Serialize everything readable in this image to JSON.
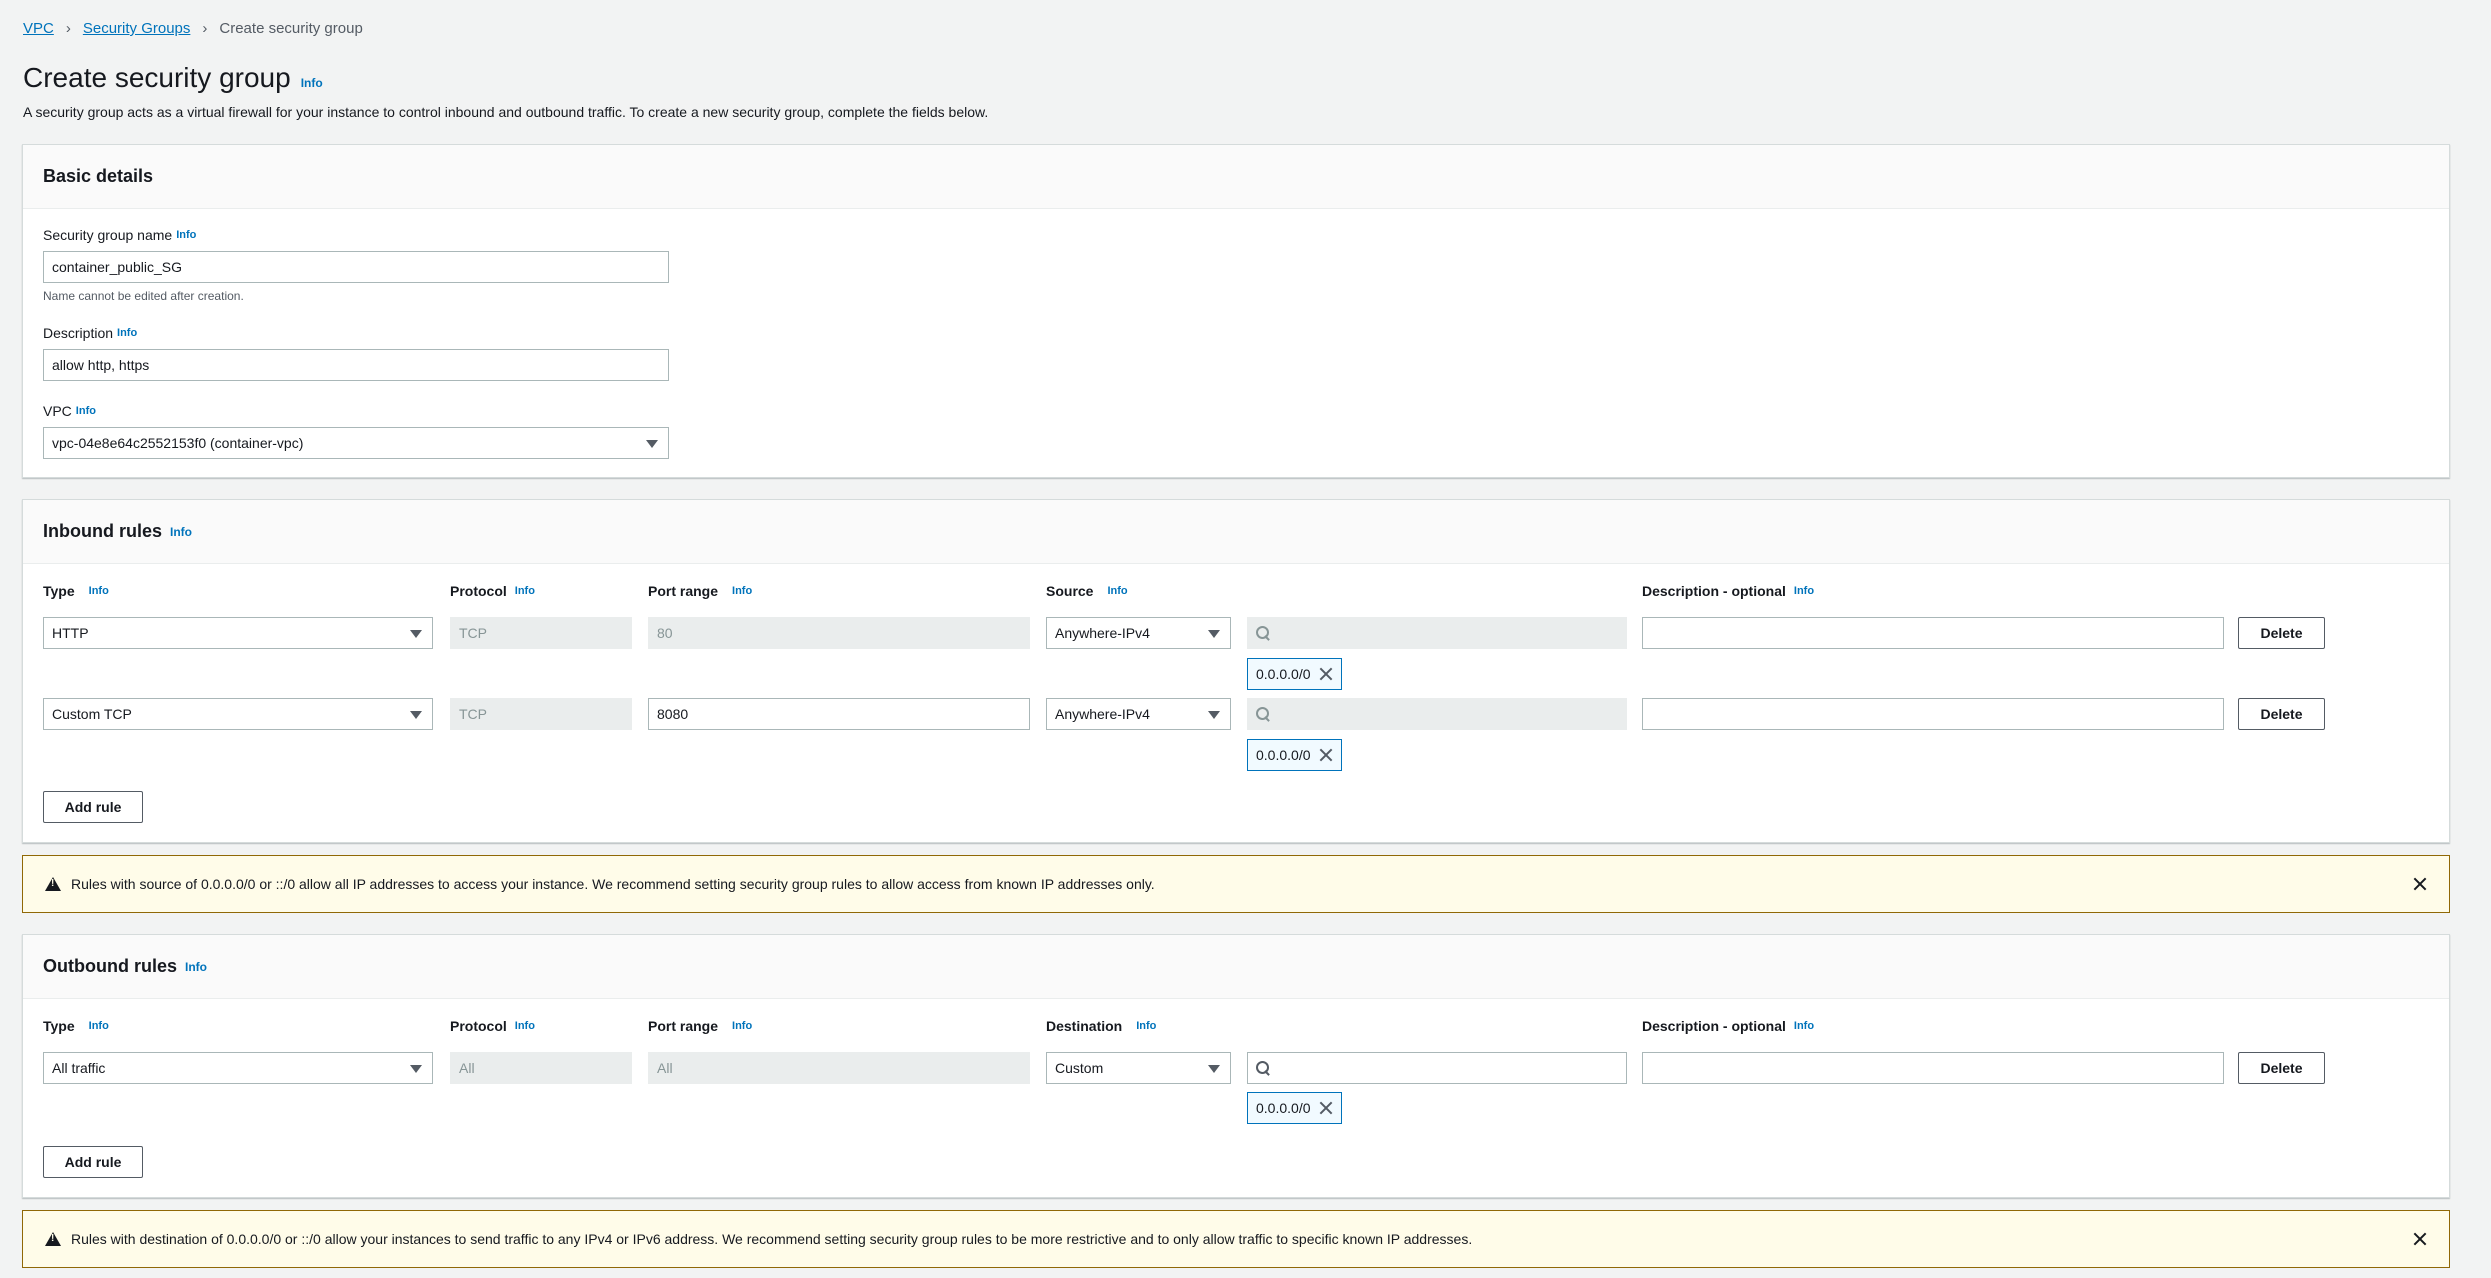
{
  "breadcrumb": {
    "vpc": "VPC",
    "security_groups": "Security Groups",
    "current": "Create security group"
  },
  "page": {
    "title": "Create security group",
    "info": "Info",
    "description": "A security group acts as a virtual firewall for your instance to control inbound and outbound traffic. To create a new security group, complete the fields below."
  },
  "basic_details": {
    "heading": "Basic details",
    "name_label": "Security group name",
    "name_value": "container_public_SG",
    "name_hint": "Name cannot be edited after creation.",
    "description_label": "Description",
    "description_value": "allow http, https",
    "vpc_label": "VPC",
    "vpc_value": "vpc-04e8e64c2552153f0 (container-vpc)"
  },
  "inbound": {
    "heading": "Inbound rules",
    "columns": {
      "type": "Type",
      "protocol": "Protocol",
      "port_range": "Port range",
      "source": "Source",
      "description": "Description - optional"
    },
    "rules": [
      {
        "type": "HTTP",
        "protocol": "TCP",
        "port": "80",
        "source": "Anywhere-IPv4",
        "cidr": "0.0.0.0/0",
        "description": ""
      },
      {
        "type": "Custom TCP",
        "protocol": "TCP",
        "port": "8080",
        "source": "Anywhere-IPv4",
        "cidr": "0.0.0.0/0",
        "description": ""
      }
    ],
    "delete_label": "Delete",
    "add_label": "Add rule"
  },
  "inbound_alert": "Rules with source of 0.0.0.0/0 or ::/0 allow all IP addresses to access your instance. We recommend setting security group rules to allow access from known IP addresses only.",
  "outbound": {
    "heading": "Outbound rules",
    "columns": {
      "type": "Type",
      "protocol": "Protocol",
      "port_range": "Port range",
      "destination": "Destination",
      "description": "Description - optional"
    },
    "rules": [
      {
        "type": "All traffic",
        "protocol": "All",
        "port": "All",
        "destination": "Custom",
        "cidr": "0.0.0.0/0",
        "description": ""
      }
    ],
    "delete_label": "Delete",
    "add_label": "Add rule"
  },
  "outbound_alert": "Rules with destination of 0.0.0.0/0 or ::/0 allow your instances to send traffic to any IPv4 or IPv6 address. We recommend setting security group rules to be more restrictive and to only allow traffic to specific known IP addresses."
}
